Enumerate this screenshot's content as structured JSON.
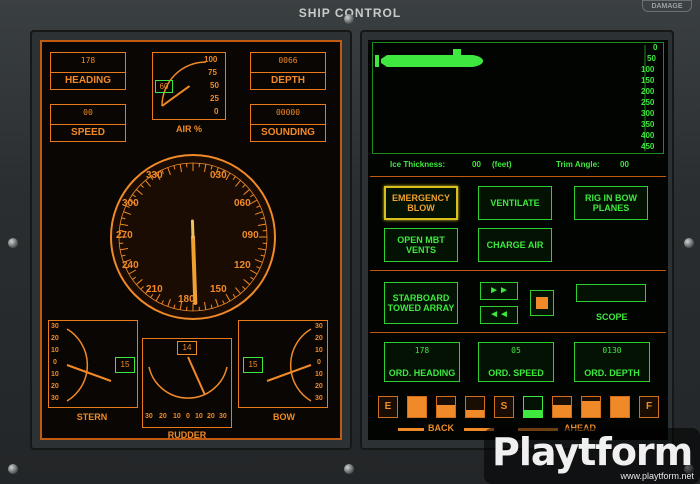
{
  "window": {
    "title": "SHIP CONTROL",
    "damage_label": "DAMAGE"
  },
  "heading": {
    "value": "178",
    "label": "HEADING"
  },
  "speed": {
    "value": "00",
    "label": "SPEED"
  },
  "depth": {
    "value": "0066",
    "label": "DEPTH"
  },
  "sounding": {
    "value": "00000",
    "label": "SOUNDING"
  },
  "air": {
    "value": "60",
    "label": "AIR %",
    "level": 60,
    "ticks": [
      "100",
      "75",
      "50",
      "25",
      "0"
    ]
  },
  "compass": {
    "heading": 178,
    "labels": [
      "330",
      "030",
      "300",
      "060",
      "270",
      "090",
      "240",
      "120",
      "210",
      "150",
      "180"
    ]
  },
  "stern": {
    "label": "STERN",
    "value": "15",
    "ticks": [
      "30",
      "20",
      "10",
      "0",
      "10",
      "20",
      "30"
    ]
  },
  "bow": {
    "label": "BOW",
    "value": "15",
    "ticks": [
      "30",
      "20",
      "10",
      "0",
      "10",
      "20",
      "30"
    ]
  },
  "rudder": {
    "label": "RUDDER",
    "value": "14",
    "ticks": [
      "30",
      "20",
      "10",
      "0",
      "10",
      "20",
      "30"
    ]
  },
  "depth_scale": [
    "0",
    "50",
    "100",
    "150",
    "200",
    "250",
    "300",
    "350",
    "400",
    "450"
  ],
  "ice": {
    "label": "Ice Thickness:",
    "value": "00",
    "unit": "(feet)"
  },
  "trim": {
    "label": "Trim Angle:",
    "value": "00"
  },
  "buttons": {
    "emergency_blow": "EMERGENCY BLOW",
    "ventilate": "VENTILATE",
    "rig_bow_planes": "RIG IN BOW PLANES",
    "open_mbt_vents": "OPEN MBT VENTS",
    "charge_air": "CHARGE AIR",
    "towed_array": "STARBOARD TOWED ARRAY",
    "scope": "SCOPE"
  },
  "orders": {
    "heading": {
      "value": "178",
      "label": "ORD. HEADING"
    },
    "speed": {
      "value": "05",
      "label": "ORD. SPEED"
    },
    "depth": {
      "value": "0130",
      "label": "ORD. DEPTH"
    }
  },
  "throttle": {
    "keys": [
      "E",
      "",
      "",
      "",
      "S",
      "",
      "",
      "",
      "",
      "F"
    ],
    "back": "BACK",
    "ahead": "AHEAD"
  },
  "watermark": {
    "name": "Playtform",
    "url": "www.playtform.net"
  },
  "colors": {
    "orange": "#f08a28",
    "green": "#3ee83e",
    "highlight": "#d8c020"
  }
}
